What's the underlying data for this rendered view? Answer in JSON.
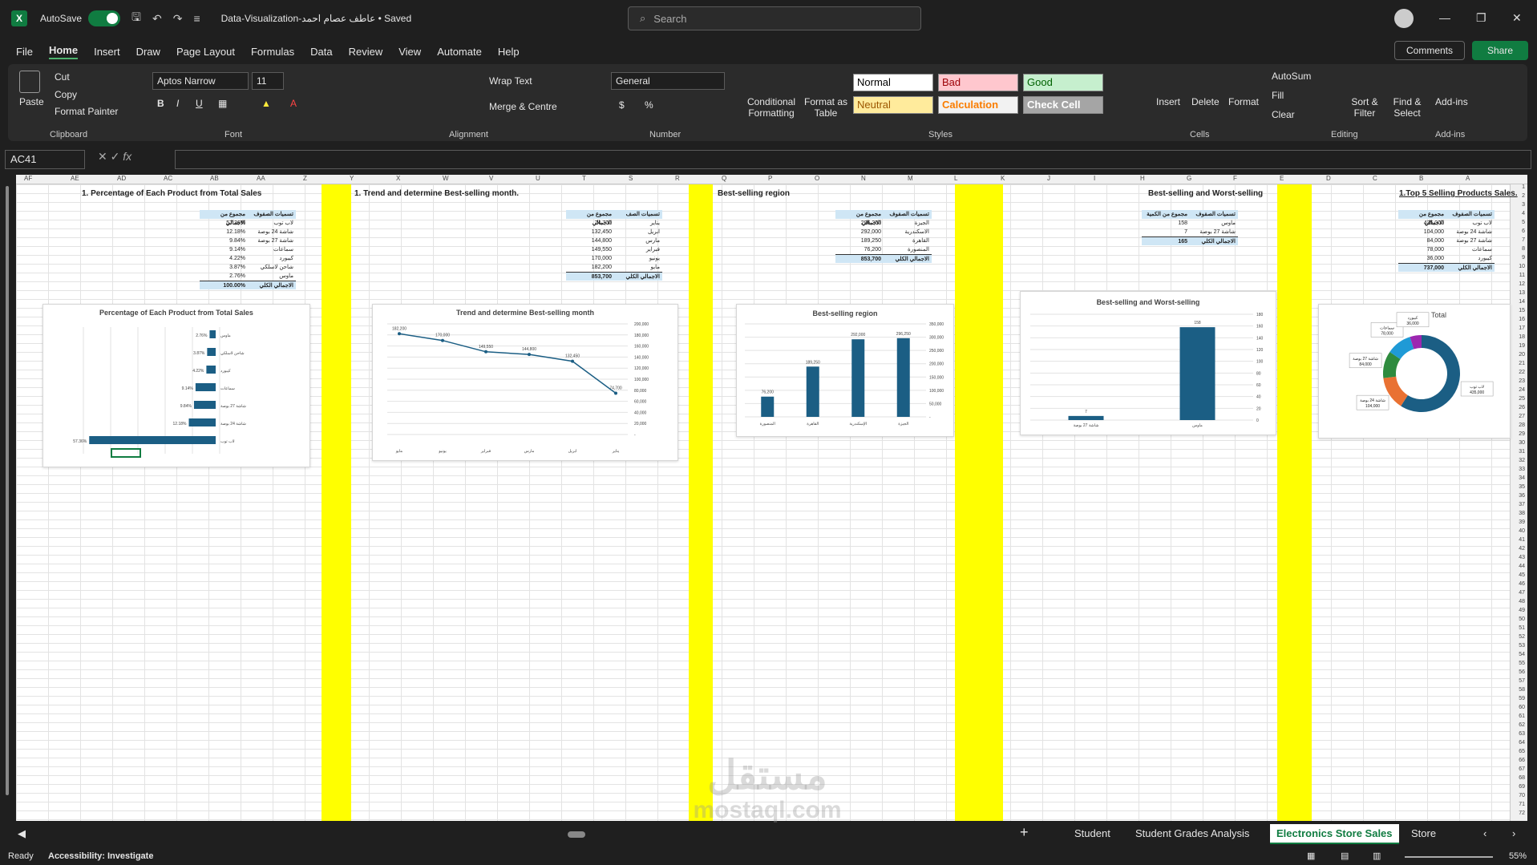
{
  "app": {
    "autosave_label": "AutoSave",
    "title": "Data-Visualization-عاطف عصام احمد • Saved",
    "search_placeholder": "Search"
  },
  "menu": [
    "File",
    "Home",
    "Insert",
    "Draw",
    "Page Layout",
    "Formulas",
    "Data",
    "Review",
    "View",
    "Automate",
    "Help"
  ],
  "menu_actions": {
    "comments": "Comments",
    "share": "Share"
  },
  "ribbon": {
    "clipboard": {
      "paste": "Paste",
      "cut": "Cut",
      "copy": "Copy",
      "format_painter": "Format Painter",
      "label": "Clipboard"
    },
    "font": {
      "family": "Aptos Narrow",
      "size": "11",
      "label": "Font"
    },
    "alignment": {
      "wrap": "Wrap Text",
      "merge": "Merge & Centre",
      "label": "Alignment"
    },
    "number": {
      "format": "General",
      "label": "Number"
    },
    "styles": {
      "conditional": "Conditional Formatting",
      "format_table": "Format as Table",
      "normal": "Normal",
      "bad": "Bad",
      "good": "Good",
      "neutral": "Neutral",
      "calculation": "Calculation",
      "check_cell": "Check Cell",
      "label": "Styles"
    },
    "cells": {
      "insert": "Insert",
      "delete": "Delete",
      "format": "Format",
      "label": "Cells"
    },
    "editing": {
      "autosum": "AutoSum",
      "fill": "Fill",
      "clear": "Clear",
      "sort": "Sort & Filter",
      "find": "Find & Select",
      "label": "Editing"
    },
    "addins": {
      "addins": "Add-ins",
      "label": "Add-ins"
    }
  },
  "formula_bar": {
    "name_box": "AC41",
    "fx": "fx",
    "value": ""
  },
  "column_headers": [
    "AF",
    "AE",
    "AD",
    "AC",
    "AB",
    "AA",
    "Z",
    "Y",
    "X",
    "W",
    "V",
    "U",
    "T",
    "S",
    "R",
    "Q",
    "P",
    "O",
    "N",
    "M",
    "L",
    "K",
    "J",
    "I",
    "H",
    "G",
    "F",
    "E",
    "D",
    "C",
    "B",
    "A"
  ],
  "sections": {
    "s1": "1.  Percentage of Each Product from Total Sales",
    "s2": "1.  Trend  and determine Best-selling month.",
    "s3": "Best-selling region",
    "s4": "Best-selling and Worst-selling",
    "s5": "1.Top 5 Selling Products Sales."
  },
  "tables": {
    "t1": {
      "h1": "مجموع من الاجمالي",
      "h2": "تسميات الصفوف",
      "rows": [
        [
          "57.36%",
          "لاب توب"
        ],
        [
          "12.18%",
          "شاشة 24 بوصة"
        ],
        [
          "9.84%",
          "شاشة 27 بوصة"
        ],
        [
          "9.14%",
          "سماعات"
        ],
        [
          "4.22%",
          "كيبورد"
        ],
        [
          "3.87%",
          "شاحن لاسلكي"
        ],
        [
          "2.76%",
          "ماوس"
        ]
      ],
      "total": [
        "100.00%",
        "الاجمالي الكلي"
      ]
    },
    "t2": {
      "h1": "مجموع من الاجمالي",
      "h2": "تسميات الصف",
      "rows": [
        [
          "74,700",
          "يناير"
        ],
        [
          "132,450",
          "ابريل"
        ],
        [
          "144,800",
          "مارس"
        ],
        [
          "149,550",
          "فبراير"
        ],
        [
          "170,000",
          "يونيو"
        ],
        [
          "182,200",
          "مايو"
        ]
      ],
      "total": [
        "853,700",
        "الاجمالي الكلي"
      ]
    },
    "t3": {
      "h1": "مجموع من الاجمالي",
      "h2": "تسميات الصفوف",
      "rows": [
        [
          "296,250",
          "الجيزة"
        ],
        [
          "292,000",
          "الاسكندرية"
        ],
        [
          "189,250",
          "القاهرة"
        ],
        [
          "76,200",
          "المنصورة"
        ]
      ],
      "total": [
        "853,700",
        "الاجمالي الكلي"
      ]
    },
    "t4": {
      "h1": "مجموع من الكمية",
      "h2": "تسميات الصفوف",
      "rows": [
        [
          "158",
          "ماوس"
        ],
        [
          "7",
          "شاشة 27 بوصة"
        ]
      ],
      "total": [
        "165",
        "الاجمالي الكلي"
      ]
    },
    "t5": {
      "h1": "مجموع من الاجمالي",
      "h2": "تسميات الصفوف",
      "rows": [
        [
          "435,000",
          "لاب توب"
        ],
        [
          "104,000",
          "شاشة 24 بوصة"
        ],
        [
          "84,000",
          "شاشة 27 بوصة"
        ],
        [
          "78,000",
          "سماعات"
        ],
        [
          "36,000",
          "كيبورد"
        ]
      ],
      "total": [
        "737,000",
        "الاجمالي الكلي"
      ]
    }
  },
  "chart_data": [
    {
      "type": "bar",
      "orientation": "horizontal",
      "title": "Percentage of Each Product from Total Sales",
      "categories": [
        "ماوس",
        "شاحن لاسلكي",
        "كيبورد",
        "سماعات",
        "شاشة 27 بوصة",
        "شاشة 24 بوصة",
        "لاب توب"
      ],
      "values": [
        2.76,
        3.87,
        4.22,
        9.14,
        9.84,
        12.18,
        57.36
      ],
      "labels": [
        "2.76%",
        "3.87%",
        "4.22%",
        "9.14%",
        "9.84%",
        "12.18%",
        "57.36%"
      ],
      "color": "#1b5e84"
    },
    {
      "type": "line",
      "title": "Trend  and determine Best-selling month",
      "categories": [
        "مايو",
        "يونيو",
        "فبراير",
        "مارس",
        "ابريل",
        "يناير"
      ],
      "values": [
        182200,
        170000,
        149550,
        144800,
        132450,
        74700
      ],
      "labels": [
        "182,200",
        "170,000",
        "149,550",
        "144,800",
        "132,450",
        "74,700"
      ],
      "yticks": [
        "200,000",
        "180,000",
        "160,000",
        "140,000",
        "120,000",
        "100,000",
        "80,000",
        "60,000",
        "40,000",
        "20,000",
        "-"
      ],
      "ylim": [
        0,
        200000
      ],
      "color": "#1b5e84"
    },
    {
      "type": "bar",
      "title": "Best-selling region",
      "categories": [
        "المنصورة",
        "القاهرة",
        "الإسكندرية",
        "الجيزة"
      ],
      "values": [
        76200,
        189250,
        292000,
        296250
      ],
      "labels": [
        "76,200",
        "189,250",
        "292,000",
        "296,250"
      ],
      "yticks": [
        "350,000",
        "300,000",
        "250,000",
        "200,000",
        "150,000",
        "100,000",
        "50,000",
        "-"
      ],
      "ylim": [
        0,
        350000
      ],
      "color": "#1b5e84"
    },
    {
      "type": "bar",
      "title": "Best-selling and Worst-selling",
      "categories": [
        "شاشة 27 بوصة",
        "ماوس"
      ],
      "values": [
        7,
        158
      ],
      "labels": [
        "7",
        "158"
      ],
      "yticks": [
        "180",
        "160",
        "140",
        "120",
        "100",
        "80",
        "60",
        "40",
        "20",
        "0"
      ],
      "ylim": [
        0,
        180
      ],
      "color": "#1b5e84"
    },
    {
      "type": "pie",
      "subtype": "doughnut",
      "title": "Total",
      "categories": [
        "لاب توب",
        "شاشة 24 بوصة",
        "شاشة 27 بوصة",
        "سماعات",
        "كيبورد"
      ],
      "values": [
        435000,
        104000,
        84000,
        78000,
        36000
      ],
      "labels": [
        "لاب توب 435,000",
        "شاشة 24 بوصة 104,000",
        "شاشة 27 بوصة 84,000",
        "سماعات 78,000",
        "كيبورد 36,000"
      ],
      "colors": [
        "#1b5e84",
        "#e97132",
        "#2e8b3e",
        "#1f9ad6",
        "#9c27b0"
      ]
    }
  ],
  "sheet_tabs": [
    "Student",
    "Student Grades Analysis",
    "Electronics Store Sales",
    "Store"
  ],
  "active_tab": "Electronics Store Sales",
  "status": {
    "ready": "Ready",
    "accessibility": "Accessibility: Investigate",
    "zoom": "55%"
  },
  "watermark": {
    "line1": "مستقل",
    "line2": "mostaql.com"
  }
}
